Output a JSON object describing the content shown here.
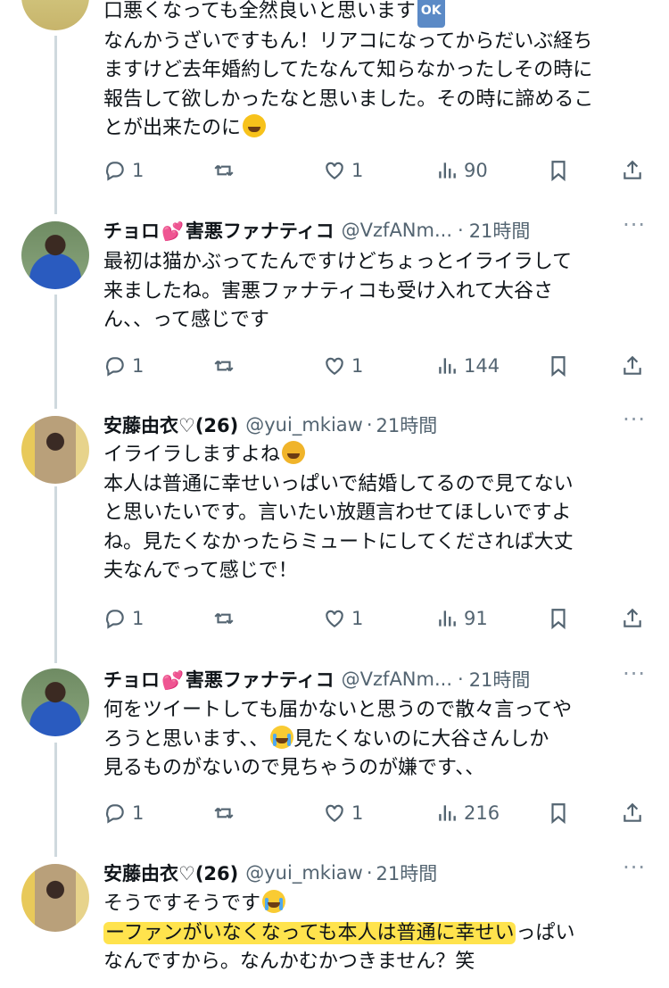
{
  "tweets": [
    {
      "lines": [
        "口悪くなっても全然良いと思います",
        "なんかうざいですもん！リアコになってからだいぶ経ち",
        "ますけど去年婚約してたなんて知らなかったしその時に",
        "報告して欲しかったなと思いました。その時に諦めるこ",
        "とが出来たのに"
      ],
      "ok_badge": "OK",
      "replies": "1",
      "likes": "1",
      "views": "90"
    },
    {
      "name": "チョロ",
      "name2": "害悪ファナティコ",
      "handle": "@VzfANm...",
      "time": "21時間",
      "lines": [
        "最初は猫かぶってたんですけどちょっとイライラして",
        "来ましたね。害悪ファナティコも受け入れて大谷さ",
        "ん、、って感じです"
      ],
      "replies": "1",
      "likes": "1",
      "views": "144"
    },
    {
      "name": "安藤由衣♡(26)",
      "handle": "@yui_mkiaw",
      "time": "21時間",
      "lines": [
        "イライラしますよね",
        "本人は普通に幸せいっぱいで結婚してるので見てない",
        "と思いたいです。言いたい放題言わせてほしいですよ",
        "ね。見たくなかったらミュートにしてくだされば大丈",
        "夫なんでって感じで！"
      ],
      "replies": "1",
      "likes": "1",
      "views": "91"
    },
    {
      "name": "チョロ",
      "name2": "害悪ファナティコ",
      "handle": "@VzfANm...",
      "time": "21時間",
      "lines": [
        "何をツイートしても届かないと思うので散々言ってや",
        "ろうと思います、、",
        "見たくないのに大谷さんしか",
        "見るものがないので見ちゃうのが嫌です、、"
      ],
      "replies": "1",
      "likes": "1",
      "views": "216"
    },
    {
      "name": "安藤由衣♡(26)",
      "handle": "@yui_mkiaw",
      "time": "21時間",
      "lines": [
        "そうですそうです",
        "ーファンがいなくなっても本人は普通に幸せい",
        "っぱい",
        "なんですから。なんかむかつきません？笑"
      ]
    }
  ],
  "separator": "·",
  "more": "···",
  "colors": {
    "text": "#0f1419",
    "muted": "#536471",
    "thread_line": "#cfd9de",
    "highlight": "#ffe34d",
    "heart": "#ff4d8d"
  },
  "icons": [
    "reply-icon",
    "retweet-icon",
    "like-icon",
    "views-icon",
    "bookmark-icon",
    "share-icon"
  ]
}
